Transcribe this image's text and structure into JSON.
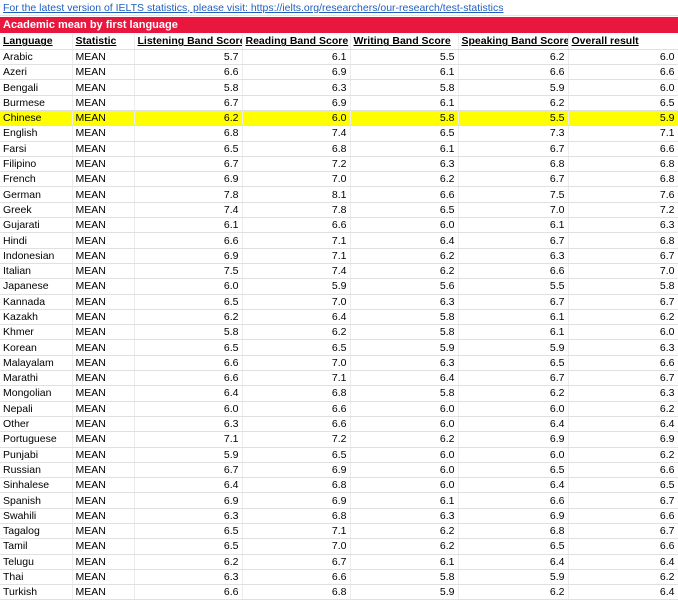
{
  "link_text": "For the latest version of IELTS statistics, please visit: https://ielts.org/researchers/our-research/test-statistics",
  "title": "Academic mean by first language",
  "highlight_color": "#ffff00",
  "title_color": "#e8173e",
  "headers": [
    "Language",
    "Statistic",
    "Listening Band Score",
    "Reading Band Score",
    "Writing Band Score",
    "Speaking Band Score",
    "Overall result"
  ],
  "rows": [
    {
      "lang": "Arabic",
      "stat": "MEAN",
      "v": [
        "5.7",
        "6.1",
        "5.5",
        "6.2",
        "6.0"
      ]
    },
    {
      "lang": "Azeri",
      "stat": "MEAN",
      "v": [
        "6.6",
        "6.9",
        "6.1",
        "6.6",
        "6.6"
      ]
    },
    {
      "lang": "Bengali",
      "stat": "MEAN",
      "v": [
        "5.8",
        "6.3",
        "5.8",
        "5.9",
        "6.0"
      ]
    },
    {
      "lang": "Burmese",
      "stat": "MEAN",
      "v": [
        "6.7",
        "6.9",
        "6.1",
        "6.2",
        "6.5"
      ]
    },
    {
      "lang": "Chinese",
      "stat": "MEAN",
      "v": [
        "6.2",
        "6.0",
        "5.8",
        "5.5",
        "5.9"
      ],
      "highlight": true
    },
    {
      "lang": "English",
      "stat": "MEAN",
      "v": [
        "6.8",
        "7.4",
        "6.5",
        "7.3",
        "7.1"
      ]
    },
    {
      "lang": "Farsi",
      "stat": "MEAN",
      "v": [
        "6.5",
        "6.8",
        "6.1",
        "6.7",
        "6.6"
      ]
    },
    {
      "lang": "Filipino",
      "stat": "MEAN",
      "v": [
        "6.7",
        "7.2",
        "6.3",
        "6.8",
        "6.8"
      ]
    },
    {
      "lang": "French",
      "stat": "MEAN",
      "v": [
        "6.9",
        "7.0",
        "6.2",
        "6.7",
        "6.8"
      ]
    },
    {
      "lang": "German",
      "stat": "MEAN",
      "v": [
        "7.8",
        "8.1",
        "6.6",
        "7.5",
        "7.6"
      ]
    },
    {
      "lang": "Greek",
      "stat": "MEAN",
      "v": [
        "7.4",
        "7.8",
        "6.5",
        "7.0",
        "7.2"
      ]
    },
    {
      "lang": "Gujarati",
      "stat": "MEAN",
      "v": [
        "6.1",
        "6.6",
        "6.0",
        "6.1",
        "6.3"
      ]
    },
    {
      "lang": "Hindi",
      "stat": "MEAN",
      "v": [
        "6.6",
        "7.1",
        "6.4",
        "6.7",
        "6.8"
      ]
    },
    {
      "lang": "Indonesian",
      "stat": "MEAN",
      "v": [
        "6.9",
        "7.1",
        "6.2",
        "6.3",
        "6.7"
      ]
    },
    {
      "lang": "Italian",
      "stat": "MEAN",
      "v": [
        "7.5",
        "7.4",
        "6.2",
        "6.6",
        "7.0"
      ]
    },
    {
      "lang": "Japanese",
      "stat": "MEAN",
      "v": [
        "6.0",
        "5.9",
        "5.6",
        "5.5",
        "5.8"
      ]
    },
    {
      "lang": "Kannada",
      "stat": "MEAN",
      "v": [
        "6.5",
        "7.0",
        "6.3",
        "6.7",
        "6.7"
      ]
    },
    {
      "lang": "Kazakh",
      "stat": "MEAN",
      "v": [
        "6.2",
        "6.4",
        "5.8",
        "6.1",
        "6.2"
      ]
    },
    {
      "lang": "Khmer",
      "stat": "MEAN",
      "v": [
        "5.8",
        "6.2",
        "5.8",
        "6.1",
        "6.0"
      ]
    },
    {
      "lang": "Korean",
      "stat": "MEAN",
      "v": [
        "6.5",
        "6.5",
        "5.9",
        "5.9",
        "6.3"
      ]
    },
    {
      "lang": "Malayalam",
      "stat": "MEAN",
      "v": [
        "6.6",
        "7.0",
        "6.3",
        "6.5",
        "6.6"
      ]
    },
    {
      "lang": "Marathi",
      "stat": "MEAN",
      "v": [
        "6.6",
        "7.1",
        "6.4",
        "6.7",
        "6.7"
      ]
    },
    {
      "lang": "Mongolian",
      "stat": "MEAN",
      "v": [
        "6.4",
        "6.8",
        "5.8",
        "6.2",
        "6.3"
      ]
    },
    {
      "lang": "Nepali",
      "stat": "MEAN",
      "v": [
        "6.0",
        "6.6",
        "6.0",
        "6.0",
        "6.2"
      ]
    },
    {
      "lang": "Other",
      "stat": "MEAN",
      "v": [
        "6.3",
        "6.6",
        "6.0",
        "6.4",
        "6.4"
      ]
    },
    {
      "lang": "Portuguese",
      "stat": "MEAN",
      "v": [
        "7.1",
        "7.2",
        "6.2",
        "6.9",
        "6.9"
      ]
    },
    {
      "lang": "Punjabi",
      "stat": "MEAN",
      "v": [
        "5.9",
        "6.5",
        "6.0",
        "6.0",
        "6.2"
      ]
    },
    {
      "lang": "Russian",
      "stat": "MEAN",
      "v": [
        "6.7",
        "6.9",
        "6.0",
        "6.5",
        "6.6"
      ]
    },
    {
      "lang": "Sinhalese",
      "stat": "MEAN",
      "v": [
        "6.4",
        "6.8",
        "6.0",
        "6.4",
        "6.5"
      ]
    },
    {
      "lang": "Spanish",
      "stat": "MEAN",
      "v": [
        "6.9",
        "6.9",
        "6.1",
        "6.6",
        "6.7"
      ]
    },
    {
      "lang": "Swahili",
      "stat": "MEAN",
      "v": [
        "6.3",
        "6.8",
        "6.3",
        "6.9",
        "6.6"
      ]
    },
    {
      "lang": "Tagalog",
      "stat": "MEAN",
      "v": [
        "6.5",
        "7.1",
        "6.2",
        "6.8",
        "6.7"
      ]
    },
    {
      "lang": "Tamil",
      "stat": "MEAN",
      "v": [
        "6.5",
        "7.0",
        "6.2",
        "6.5",
        "6.6"
      ]
    },
    {
      "lang": "Telugu",
      "stat": "MEAN",
      "v": [
        "6.2",
        "6.7",
        "6.1",
        "6.4",
        "6.4"
      ]
    },
    {
      "lang": "Thai",
      "stat": "MEAN",
      "v": [
        "6.3",
        "6.6",
        "5.8",
        "5.9",
        "6.2"
      ]
    },
    {
      "lang": "Turkish",
      "stat": "MEAN",
      "v": [
        "6.6",
        "6.8",
        "5.9",
        "6.2",
        "6.4"
      ]
    }
  ]
}
